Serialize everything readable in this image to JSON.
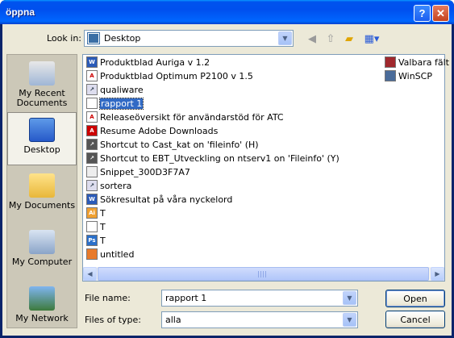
{
  "window": {
    "title": "öppna",
    "help_label": "?",
    "close_label": "✕"
  },
  "toolbar": {
    "look_in_label": "Look in:",
    "look_in_value": "Desktop",
    "back_icon": "back-icon",
    "up_icon": "up-folder-icon",
    "new_folder_icon": "new-folder-icon",
    "views_icon": "views-menu-icon"
  },
  "places": [
    {
      "label": "My Recent Documents",
      "icon": "recent-documents-icon",
      "selected": false
    },
    {
      "label": "Desktop",
      "icon": "desktop-icon",
      "selected": true
    },
    {
      "label": "My Documents",
      "icon": "my-documents-icon",
      "selected": false
    },
    {
      "label": "My Computer",
      "icon": "my-computer-icon",
      "selected": false
    },
    {
      "label": "My Network",
      "icon": "my-network-icon",
      "selected": false
    }
  ],
  "files_col1": [
    {
      "name": "Produktblad Auriga v 1.2",
      "icon": "word-doc-icon"
    },
    {
      "name": "Produktblad Optimum P2100 v 1.5",
      "icon": "pdf-icon"
    },
    {
      "name": "qualiware",
      "icon": "shortcut-icon"
    },
    {
      "name": "rapport 1",
      "icon": "text-file-icon",
      "selected": true
    },
    {
      "name": "Releaseöversikt för användarstöd för ATC",
      "icon": "pdf-icon"
    },
    {
      "name": "Resume Adobe Downloads",
      "icon": "adobe-icon"
    },
    {
      "name": "Shortcut to Cast_kat on 'fileinfo' (H)",
      "icon": "network-shortcut-icon"
    },
    {
      "name": "Shortcut to EBT_Utveckling on ntserv1 on 'Fileinfo' (Y)",
      "icon": "network-shortcut-icon"
    },
    {
      "name": "Snippet_300D3F7A7",
      "icon": "snippet-icon"
    },
    {
      "name": "sortera",
      "icon": "shortcut-icon"
    },
    {
      "name": "Sökresultat på våra nyckelord",
      "icon": "word-doc-icon"
    },
    {
      "name": "T",
      "icon": "illustrator-icon"
    },
    {
      "name": "T",
      "icon": "text-file-icon"
    },
    {
      "name": "T",
      "icon": "photoshop-icon"
    },
    {
      "name": "untitled",
      "icon": "image-file-icon"
    }
  ],
  "files_col2": [
    {
      "name": "Valbara fält",
      "icon": "access-icon"
    },
    {
      "name": "WinSCP",
      "icon": "winscp-icon"
    }
  ],
  "bottom": {
    "file_name_label": "File name:",
    "file_name_value": "rapport 1",
    "file_type_label": "Files of type:",
    "file_type_value": "alla",
    "open_label": "Open",
    "cancel_label": "Cancel"
  }
}
